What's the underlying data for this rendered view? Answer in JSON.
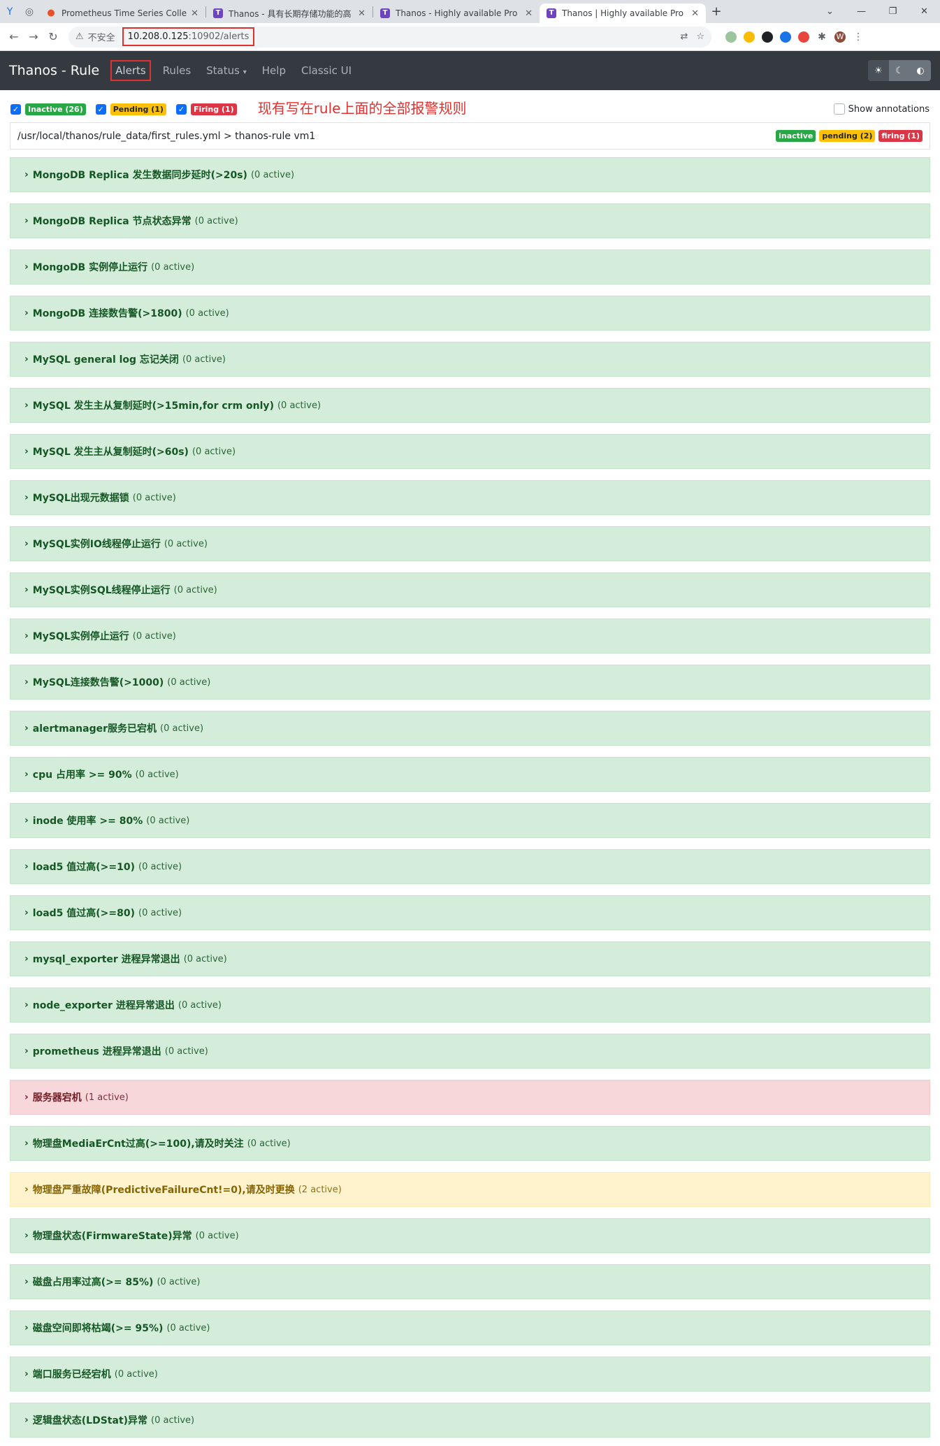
{
  "browser": {
    "tabs": [
      {
        "title": "Prometheus Time Series Colle",
        "icon": "prometheus-icon",
        "active": false
      },
      {
        "title": "Thanos - 具有长期存储功能的高",
        "icon": "thanos-icon",
        "active": false
      },
      {
        "title": "Thanos - Highly available Pro",
        "icon": "thanos-icon",
        "active": false
      },
      {
        "title": "Thanos | Highly available Pro",
        "icon": "thanos-icon",
        "active": true
      }
    ],
    "security_label": "不安全",
    "url_host": "10.208.0.125",
    "url_path": ":10902/alerts",
    "profile_initial": "W"
  },
  "navbar": {
    "brand": "Thanos - Rule",
    "links": [
      "Alerts",
      "Rules",
      "Status",
      "Help",
      "Classic UI"
    ]
  },
  "filters": {
    "inactive": "Inactive (26)",
    "pending": "Pending (1)",
    "firing": "Firing (1)",
    "note": "现有写在rule上面的全部报警规则",
    "show_annotations": "Show annotations"
  },
  "group": {
    "path": "/usr/local/thanos/rule_data/first_rules.yml > thanos-rule vm1",
    "badge_inactive": "inactive",
    "badge_pending": "pending (2)",
    "badge_firing": "firing (1)"
  },
  "rules": [
    {
      "name": "MongoDB Replica 发生数据同步延时(>20s)",
      "count": "(0 active)",
      "state": "inactive"
    },
    {
      "name": "MongoDB Replica 节点状态异常",
      "count": "(0 active)",
      "state": "inactive"
    },
    {
      "name": "MongoDB 实例停止运行",
      "count": "(0 active)",
      "state": "inactive"
    },
    {
      "name": "MongoDB 连接数告警(>1800)",
      "count": "(0 active)",
      "state": "inactive"
    },
    {
      "name": "MySQL general log 忘记关闭",
      "count": "(0 active)",
      "state": "inactive"
    },
    {
      "name": "MySQL 发生主从复制延时(>15min,for crm only)",
      "count": "(0 active)",
      "state": "inactive"
    },
    {
      "name": "MySQL 发生主从复制延时(>60s)",
      "count": "(0 active)",
      "state": "inactive"
    },
    {
      "name": "MySQL出现元数据锁",
      "count": "(0 active)",
      "state": "inactive"
    },
    {
      "name": "MySQL实例IO线程停止运行",
      "count": "(0 active)",
      "state": "inactive"
    },
    {
      "name": "MySQL实例SQL线程停止运行",
      "count": "(0 active)",
      "state": "inactive"
    },
    {
      "name": "MySQL实例停止运行",
      "count": "(0 active)",
      "state": "inactive"
    },
    {
      "name": "MySQL连接数告警(>1000)",
      "count": "(0 active)",
      "state": "inactive"
    },
    {
      "name": "alertmanager服务已宕机",
      "count": "(0 active)",
      "state": "inactive"
    },
    {
      "name": "cpu 占用率 >= 90%",
      "count": "(0 active)",
      "state": "inactive"
    },
    {
      "name": "inode 使用率 >= 80%",
      "count": "(0 active)",
      "state": "inactive"
    },
    {
      "name": "load5 值过高(>=10)",
      "count": "(0 active)",
      "state": "inactive"
    },
    {
      "name": "load5 值过高(>=80)",
      "count": "(0 active)",
      "state": "inactive"
    },
    {
      "name": "mysql_exporter 进程异常退出",
      "count": "(0 active)",
      "state": "inactive"
    },
    {
      "name": "node_exporter 进程异常退出",
      "count": "(0 active)",
      "state": "inactive"
    },
    {
      "name": "prometheus 进程异常退出",
      "count": "(0 active)",
      "state": "inactive"
    },
    {
      "name": "服务器宕机",
      "count": "(1 active)",
      "state": "firing"
    },
    {
      "name": "物理盘MediaErCnt过高(>=100),请及时关注",
      "count": "(0 active)",
      "state": "inactive"
    },
    {
      "name": "物理盘严重故障(PredictiveFailureCnt!=0),请及时更换",
      "count": "(2 active)",
      "state": "pending"
    },
    {
      "name": "物理盘状态(FirmwareState)异常",
      "count": "(0 active)",
      "state": "inactive"
    },
    {
      "name": "磁盘占用率过高(>= 85%)",
      "count": "(0 active)",
      "state": "inactive"
    },
    {
      "name": "磁盘空间即将枯竭(>= 95%)",
      "count": "(0 active)",
      "state": "inactive"
    },
    {
      "name": "端口服务已经宕机",
      "count": "(0 active)",
      "state": "inactive"
    },
    {
      "name": "逻辑盘状态(LDStat)异常",
      "count": "(0 active)",
      "state": "inactive"
    }
  ]
}
